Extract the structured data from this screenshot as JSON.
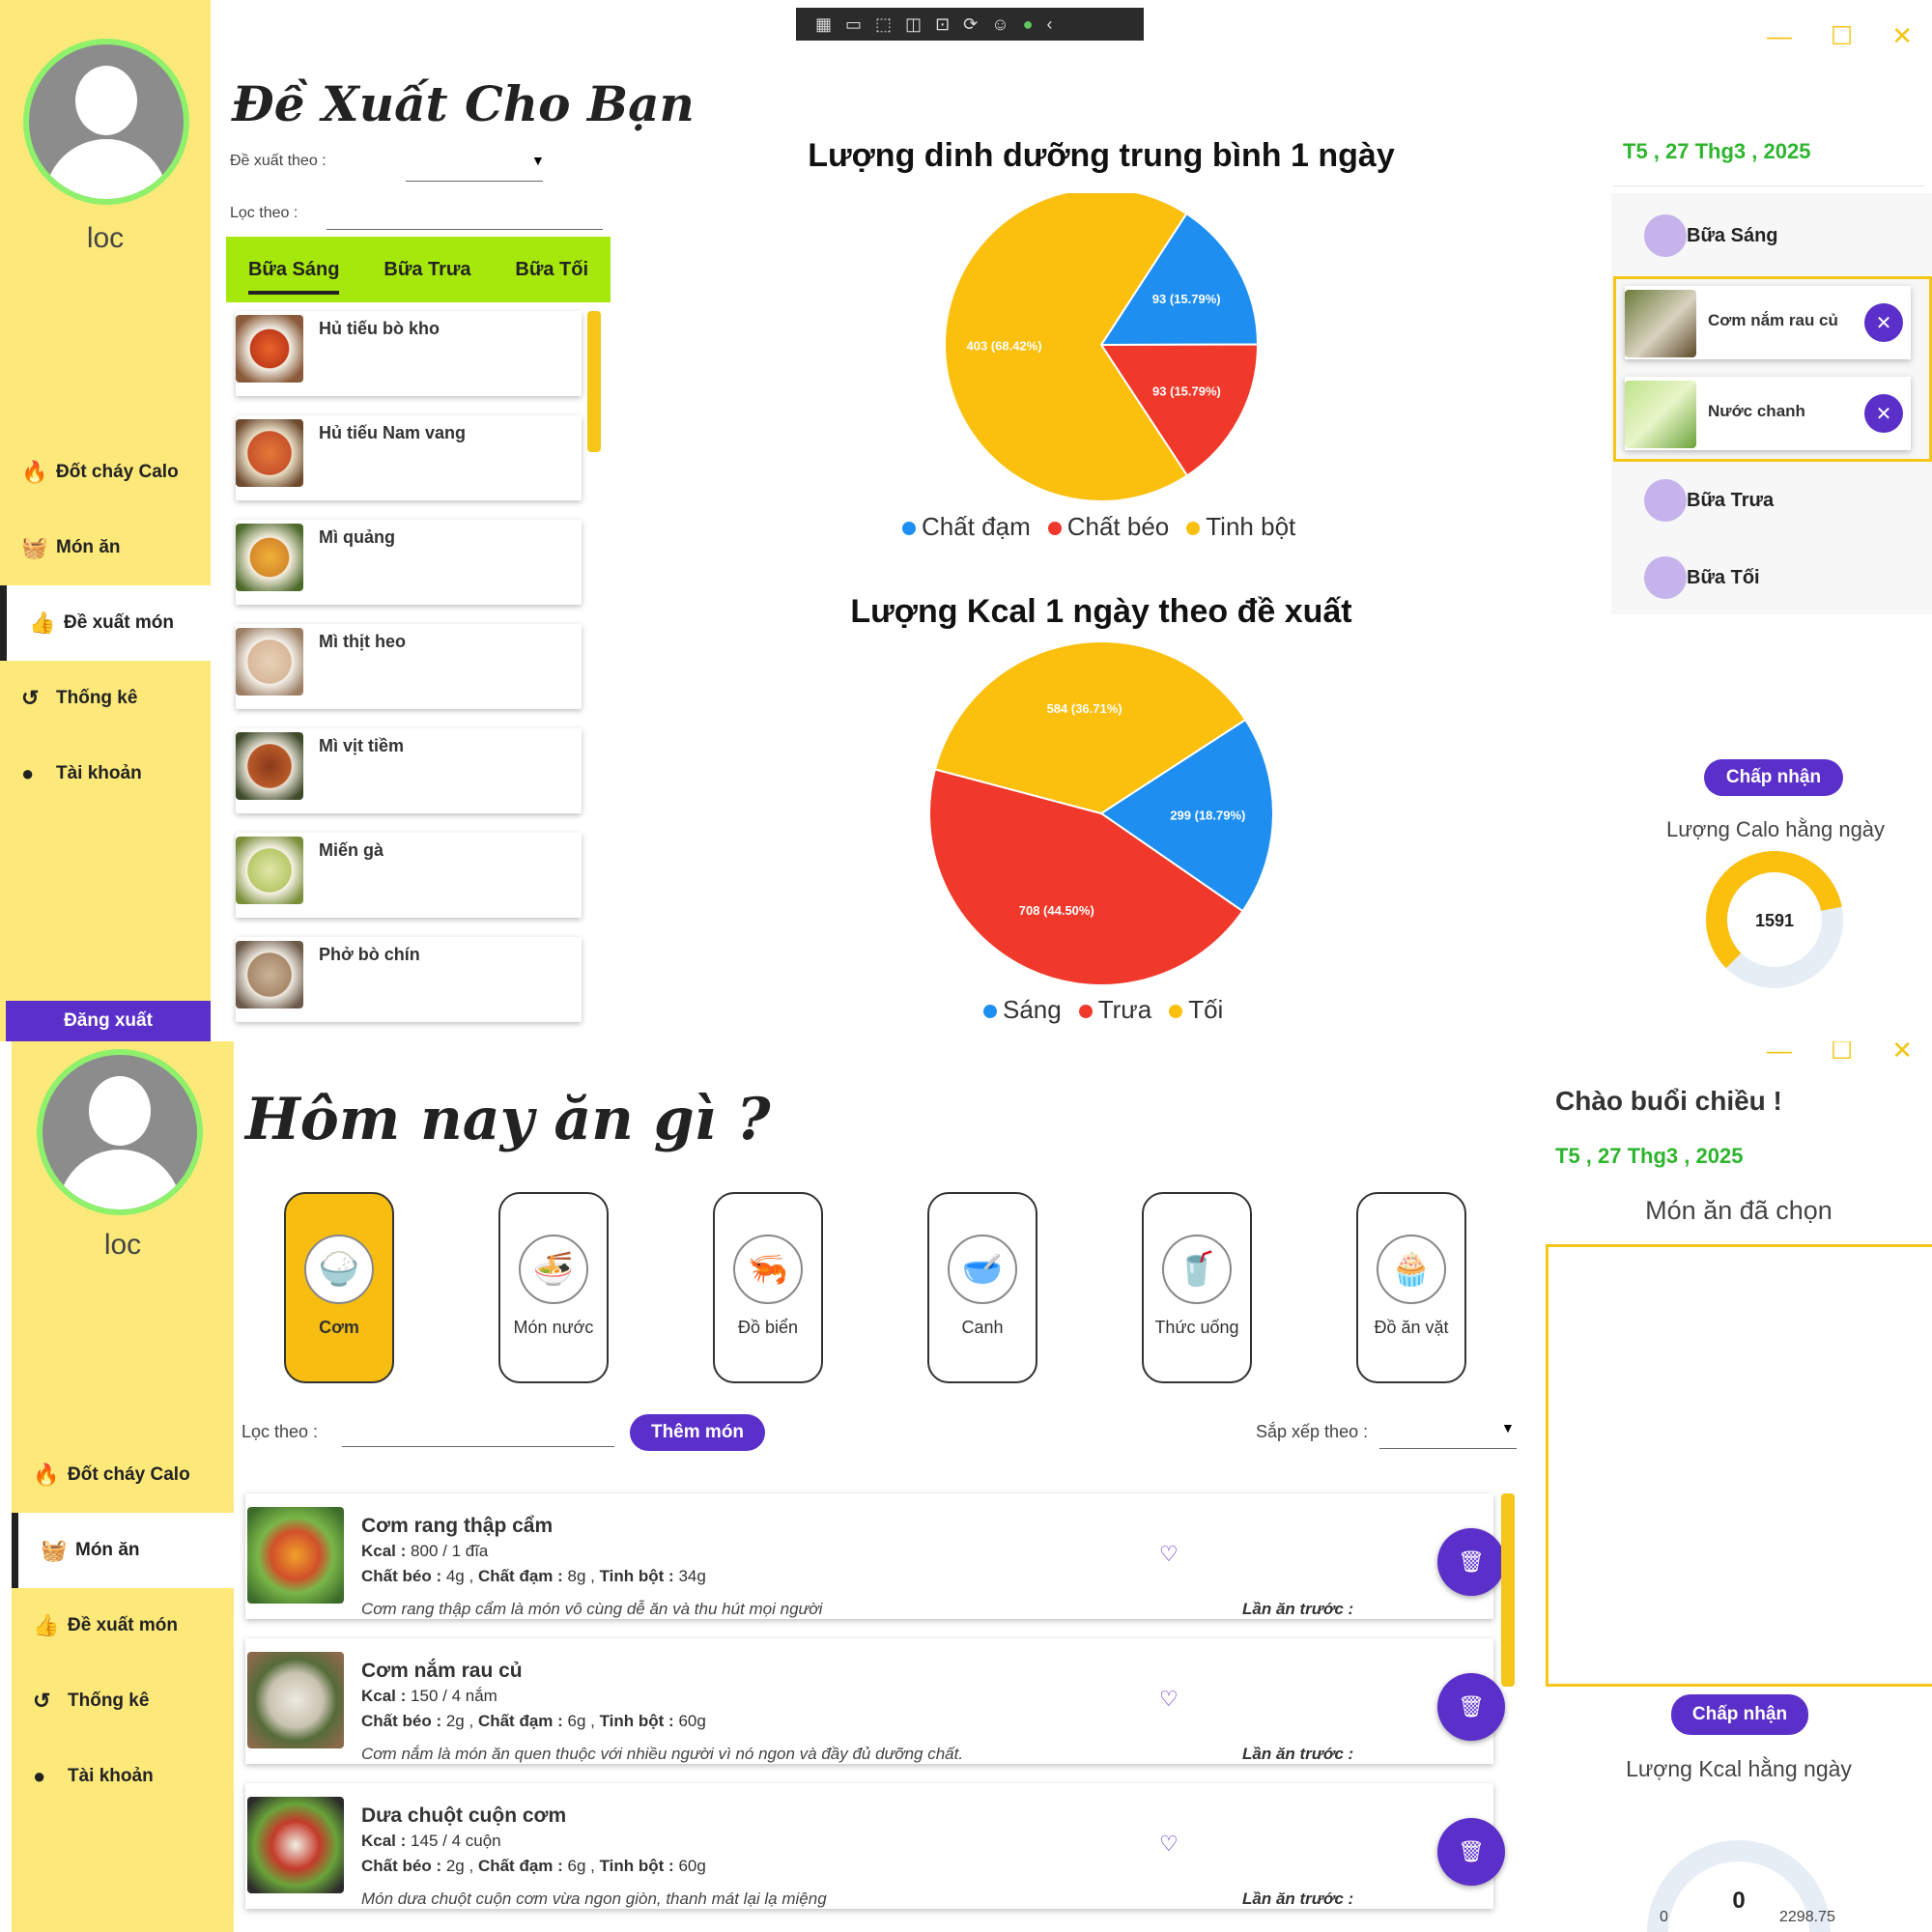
{
  "window1": {
    "title": "Đề Xuất Cho Bạn",
    "user": "loc",
    "filter": {
      "suggest_label": "Đề xuất theo :",
      "suggest_value": "",
      "filter_label": "Lọc theo :",
      "filter_value": ""
    },
    "tabs": [
      "Bữa Sáng",
      "Bữa Trưa",
      "Bữa Tối"
    ],
    "active_tab": 0,
    "food_list": [
      "Hủ tiếu bò kho",
      "Hủ tiếu Nam vang",
      "Mì quảng",
      "Mì thịt heo",
      "Mì vịt tiềm",
      "Miến gà",
      "Phở bò chín"
    ],
    "nav": [
      {
        "icon": "flame-icon",
        "label": "Đốt cháy Calo"
      },
      {
        "icon": "food-basket-icon",
        "label": "Món ăn"
      },
      {
        "icon": "thumbs-up-icon",
        "label": "Đề xuất món"
      },
      {
        "icon": "history-icon",
        "label": "Thống kê"
      },
      {
        "icon": "account-icon",
        "label": "Tài khoản"
      }
    ],
    "active_nav": 2,
    "logout_label": "Đăng xuất",
    "date": "T5 , 27 Thg3 , 2025",
    "meals": {
      "breakfast": "Bữa Sáng",
      "lunch": "Bữa Trưa",
      "dinner": "Bữa Tối",
      "breakfast_items": [
        "Cơm nắm rau củ",
        "Nước chanh"
      ]
    },
    "accept_label": "Chấp nhận",
    "calorie_label": "Lượng Calo hằng ngày",
    "calorie_value": "1591",
    "calorie_fraction": 0.7
  },
  "chart_data": [
    {
      "type": "pie",
      "title": "Lượng dinh dưỡng trung bình 1 ngày",
      "slices": [
        {
          "name": "Chất đạm",
          "value": 93,
          "label": "93 (15.79%)",
          "color": "#1e8ff0"
        },
        {
          "name": "Chất béo",
          "value": 93,
          "label": "93 (15.79%)",
          "color": "#f0392b"
        },
        {
          "name": "Tinh bột",
          "value": 403,
          "label": "403 (68.42%)",
          "color": "#fbbf0e"
        }
      ]
    },
    {
      "type": "pie",
      "title": "Lượng Kcal 1 ngày theo đề xuất",
      "slices": [
        {
          "name": "Sáng",
          "value": 299,
          "label": "299 (18.79%)",
          "color": "#1e8ff0"
        },
        {
          "name": "Trưa",
          "value": 708,
          "label": "708 (44.50%)",
          "color": "#f0392b"
        },
        {
          "name": "Tối",
          "value": 584,
          "label": "584 (36.71%)",
          "color": "#fbbf0e"
        }
      ]
    }
  ],
  "window2": {
    "title": "Hôm nay ăn gì ?",
    "user": "loc",
    "categories": [
      {
        "label": "Cơm",
        "icon": "rice-bowl-icon",
        "glyph": "🍚"
      },
      {
        "label": "Món nước",
        "icon": "noodle-bowl-icon",
        "glyph": "🍜"
      },
      {
        "label": "Đồ biển",
        "icon": "seafood-icon",
        "glyph": "🦐"
      },
      {
        "label": "Canh",
        "icon": "soup-icon",
        "glyph": "🥣"
      },
      {
        "label": "Thức uống",
        "icon": "drink-icon",
        "glyph": "🥤"
      },
      {
        "label": "Đồ ăn vặt",
        "icon": "cupcake-icon",
        "glyph": "🧁"
      }
    ],
    "active_category": 0,
    "filter_label": "Lọc theo :",
    "filter_value": "",
    "add_label": "Thêm món",
    "sort_label": "Sắp xếp theo :",
    "sort_value": "",
    "greeting": "Chào buổi chiều !",
    "date": "T5 , 27 Thg3 , 2025",
    "selected_title": "Món ăn đã chọn",
    "accept_label": "Chấp nhận",
    "kcal_label": "Lượng Kcal hằng ngày",
    "kcal_value": "0",
    "kcal_min": "0",
    "kcal_max": "2298.75",
    "dishes": [
      {
        "name": "Cơm rang thập cẩm",
        "kcal_label": "Kcal :",
        "kcal": "800 / 1 đĩa",
        "fat_label": "Chất béo :",
        "fat": "4g",
        "protein_label": "Chất đạm :",
        "protein": "8g",
        "carb_label": "Tinh bột :",
        "carb": "34g",
        "desc": "Cơm rang thập cẩm là món vô cùng dễ ăn và thu hút mọi người",
        "last_label": "Lần ăn trước :"
      },
      {
        "name": "Cơm nắm rau củ",
        "kcal_label": "Kcal :",
        "kcal": "150 / 4 nắm",
        "fat_label": "Chất béo :",
        "fat": "2g",
        "protein_label": "Chất đạm :",
        "protein": "6g",
        "carb_label": "Tinh bột :",
        "carb": "60g",
        "desc": "Cơm nắm là món ăn quen thuộc với nhiều người vì nó ngon và đầy đủ dưỡng chất.",
        "last_label": "Lần ăn trước :"
      },
      {
        "name": "Dưa chuột cuộn cơm",
        "kcal_label": "Kcal :",
        "kcal": "145 / 4 cuộn",
        "fat_label": "Chất béo :",
        "fat": "2g",
        "protein_label": "Chất đạm :",
        "protein": "6g",
        "carb_label": "Tinh bột :",
        "carb": "60g",
        "desc": "Món dưa chuột cuộn cơm vừa ngon giòn, thanh mát lại lạ miệng",
        "last_label": "Lần ăn trước :"
      }
    ]
  }
}
